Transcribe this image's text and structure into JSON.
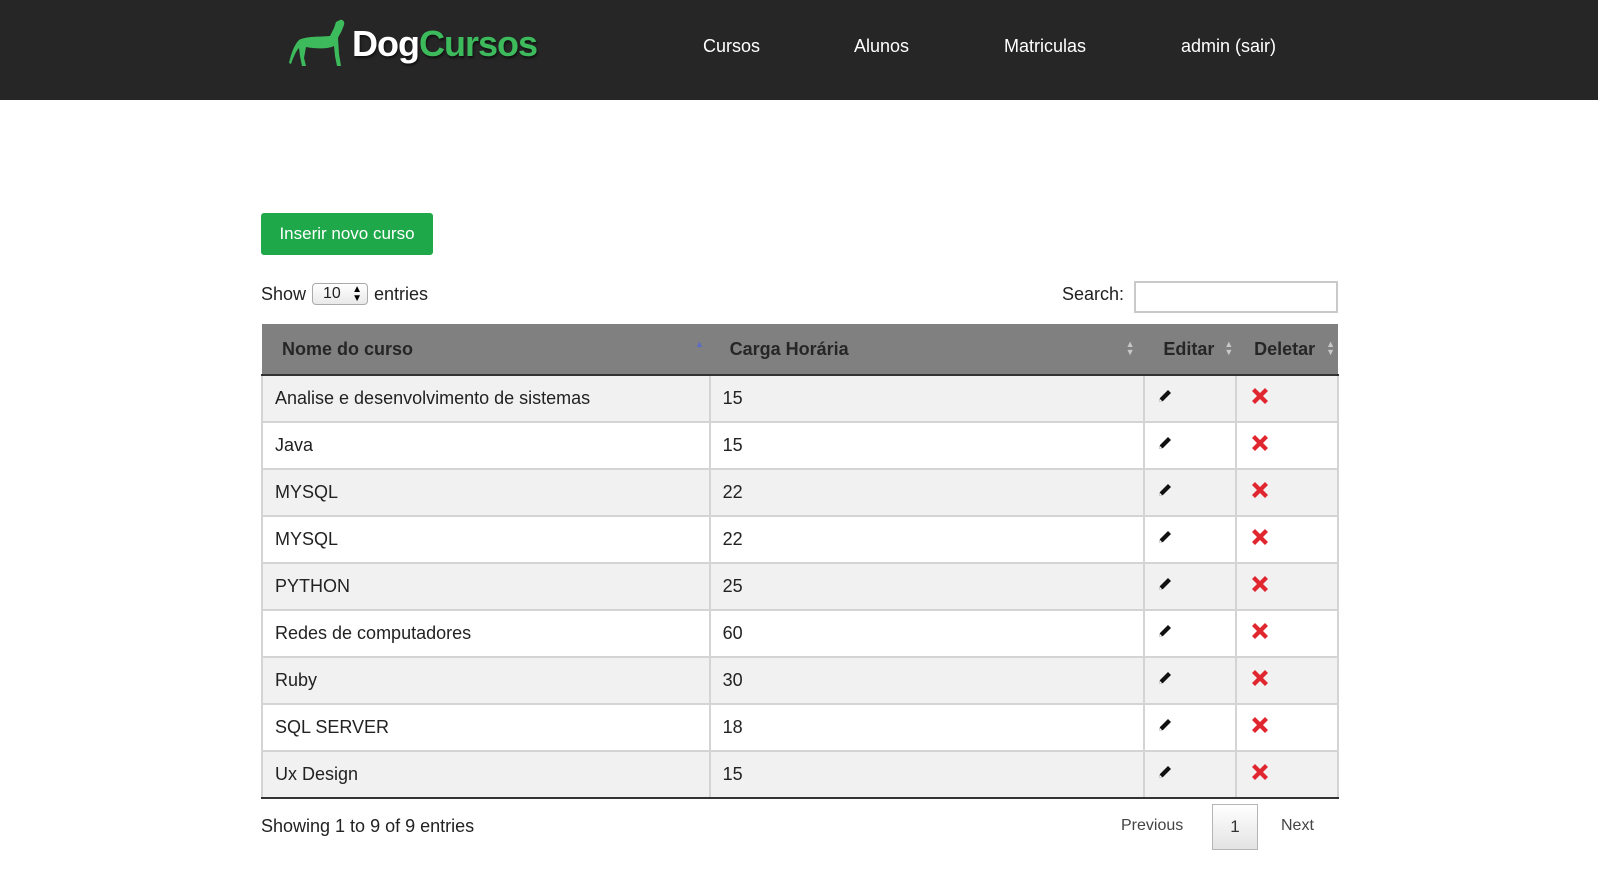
{
  "header": {
    "brand_dog": "Dog",
    "brand_cursos": "Cursos",
    "nav": [
      "Cursos",
      "Alunos",
      "Matriculas",
      "admin (sair)"
    ]
  },
  "toolbar": {
    "new_button": "Inserir novo curso"
  },
  "table_controls": {
    "show_label": "Show",
    "entries_value": "10",
    "entries_label": "entries",
    "search_label": "Search:",
    "search_value": ""
  },
  "table": {
    "columns": [
      "Nome do curso",
      "Carga Horária",
      "Editar",
      "Deletar"
    ],
    "rows": [
      {
        "nome": "Analise e desenvolvimento de sistemas",
        "carga": "15"
      },
      {
        "nome": "Java",
        "carga": "15"
      },
      {
        "nome": "MYSQL",
        "carga": "22"
      },
      {
        "nome": "MYSQL",
        "carga": "22"
      },
      {
        "nome": "PYTHON",
        "carga": "25"
      },
      {
        "nome": "Redes de computadores",
        "carga": "60"
      },
      {
        "nome": "Ruby",
        "carga": "30"
      },
      {
        "nome": "SQL SERVER",
        "carga": "18"
      },
      {
        "nome": "Ux Design",
        "carga": "15"
      }
    ]
  },
  "footer": {
    "info": "Showing 1 to 9 of 9 entries",
    "previous": "Previous",
    "page": "1",
    "next": "Next"
  },
  "icons": {
    "logo": "dog-silhouette-icon",
    "edit": "pencil-icon",
    "delete": "red-x-icon",
    "sort": "sort-arrows-icon"
  },
  "colors": {
    "topbar": "#262626",
    "brand_green": "#3dbb5c",
    "button_green": "#1ea84a",
    "table_header": "#808080",
    "delete_red": "#e0262e"
  }
}
